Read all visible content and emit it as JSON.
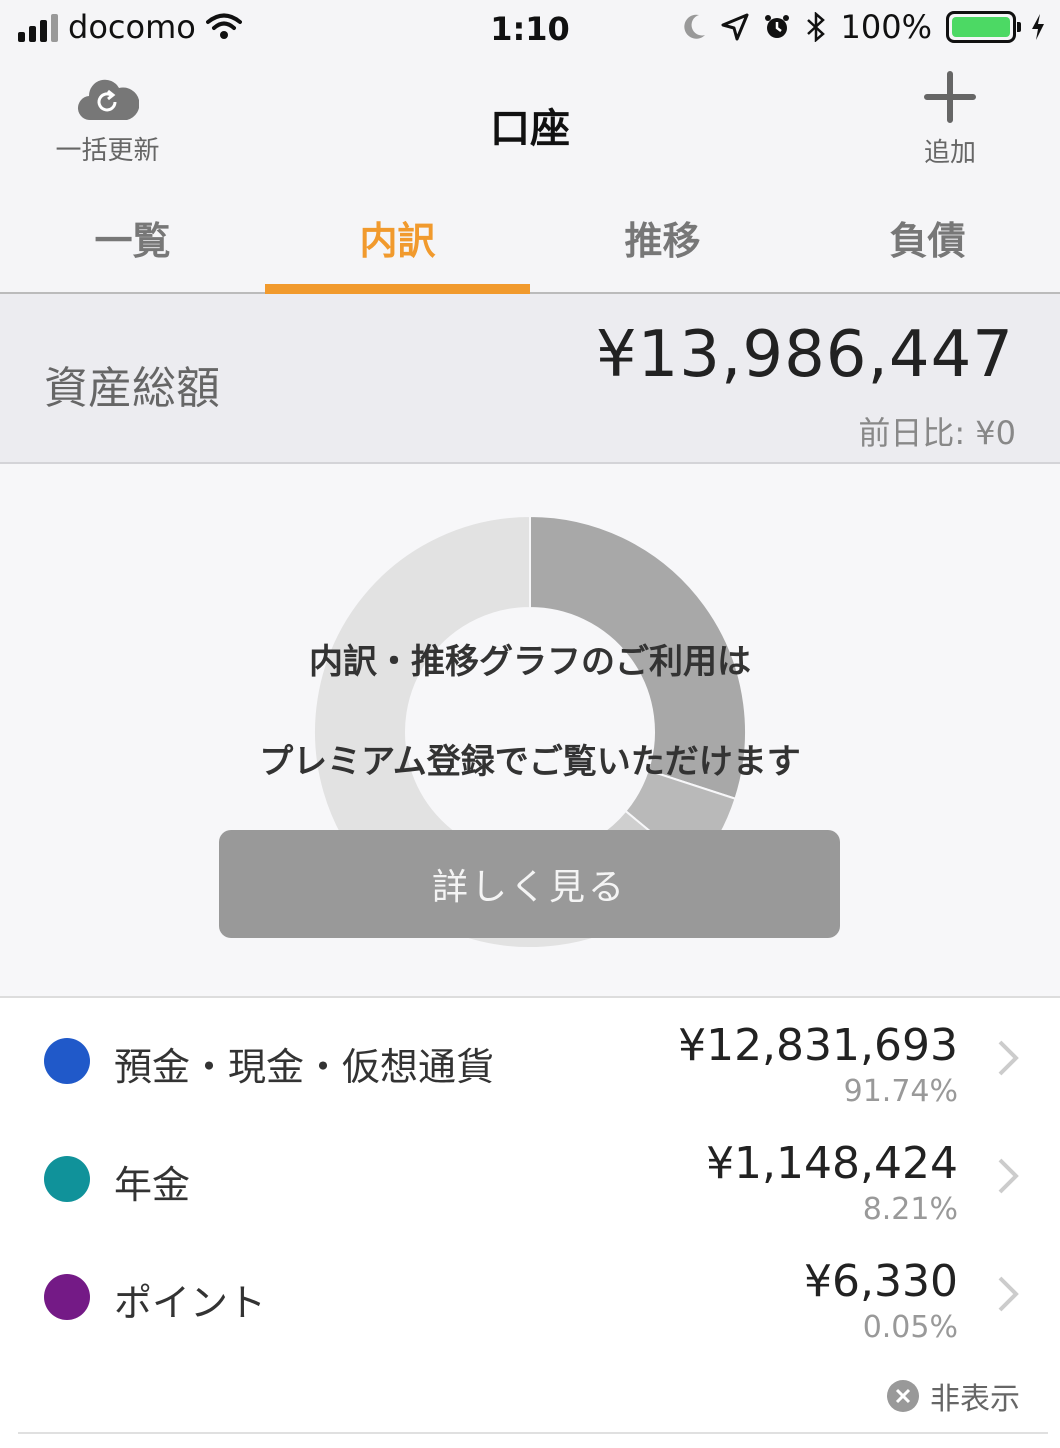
{
  "status": {
    "carrier": "docomo",
    "time": "1:10",
    "battery": "100%"
  },
  "nav": {
    "title": "口座",
    "left_label": "一括更新",
    "right_label": "追加"
  },
  "tabs": [
    {
      "label": "一覧"
    },
    {
      "label": "内訳"
    },
    {
      "label": "推移"
    },
    {
      "label": "負債"
    }
  ],
  "active_tab": "内訳",
  "total": {
    "label": "資産総額",
    "amount": "¥13,986,447",
    "diff": "前日比: ¥0"
  },
  "chart": {
    "message_line1": "内訳・推移グラフのご利用は",
    "message_line2": "プレミアム登録でご覧いただけます",
    "button_label": "詳しく見る"
  },
  "chart_data": {
    "type": "pie",
    "categories": [
      "預金・現金・仮想通貨",
      "年金",
      "ポイント"
    ],
    "values": [
      12831693,
      1148424,
      6330
    ]
  },
  "items": [
    {
      "name": "預金・現金・仮想通貨",
      "amount": "¥12,831,693",
      "percent": "91.74%",
      "color": "#2059c9"
    },
    {
      "name": "年金",
      "amount": "¥1,148,424",
      "percent": "8.21%",
      "color": "#10929a"
    },
    {
      "name": "ポイント",
      "amount": "¥6,330",
      "percent": "0.05%",
      "color": "#741a86"
    }
  ],
  "hide_label": "非表示",
  "colors": {
    "accent": "#f19a2d"
  }
}
